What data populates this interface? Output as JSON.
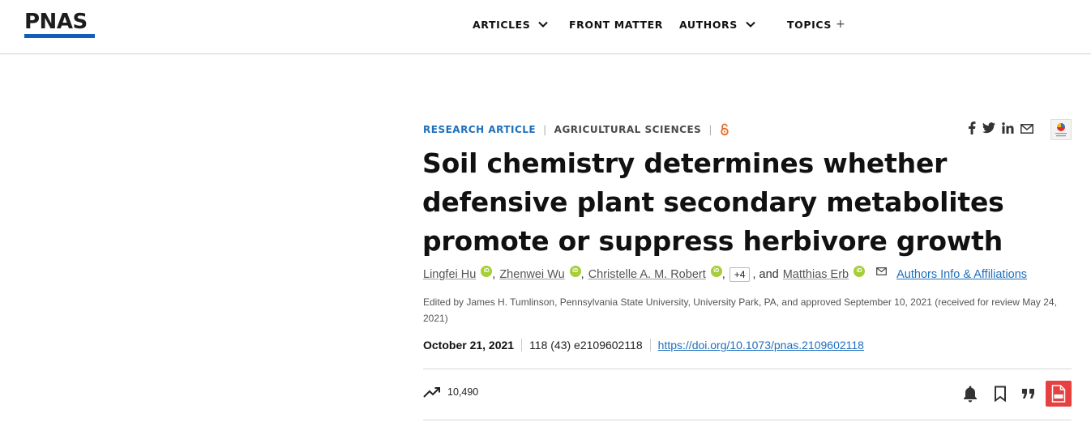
{
  "header": {
    "logo": "PNAS",
    "nav": [
      {
        "label": "ARTICLES",
        "has_dropdown": true
      },
      {
        "label": "FRONT MATTER",
        "has_dropdown": false
      },
      {
        "label": "AUTHORS",
        "has_dropdown": true
      },
      {
        "label": "TOPICS",
        "has_dropdown": false,
        "suffix": "+"
      }
    ]
  },
  "article": {
    "type": "RESEARCH ARTICLE",
    "category": "AGRICULTURAL SCIENCES",
    "open_access_icon": "open-access-icon",
    "title": "Soil chemistry determines whether defensive plant secondary metabolites promote or suppress herbivore growth",
    "authors": [
      {
        "name": "Lingfei Hu",
        "orcid": true
      },
      {
        "name": "Zhenwei Wu",
        "orcid": true
      },
      {
        "name": "Christelle A. M. Robert",
        "orcid": true
      }
    ],
    "more_authors": "+4",
    "and_text": ", and",
    "last_author": {
      "name": "Matthias Erb",
      "orcid": true,
      "email": true
    },
    "affiliations_link": "Authors Info & Affiliations",
    "edited_by": "Edited by James H. Tumlinson, Pennsylvania State University, University Park, PA, and approved September 10, 2021 (received for review May 24, 2021)",
    "date": "October 21, 2021",
    "volume": "118 (43) e2109602118",
    "doi": "https://doi.org/10.1073/pnas.2109602118",
    "views": "10,490"
  },
  "share_icons": [
    "facebook-icon",
    "twitter-icon",
    "linkedin-icon",
    "email-icon"
  ],
  "action_icons": [
    "bell-icon",
    "bookmark-icon",
    "quote-icon",
    "pdf-icon"
  ],
  "colors": {
    "accent": "#1f6fbd",
    "logo_bar": "#0f60b6",
    "orcid": "#a6ce39",
    "open_access": "#e86a2b",
    "pdf": "#e64040"
  }
}
